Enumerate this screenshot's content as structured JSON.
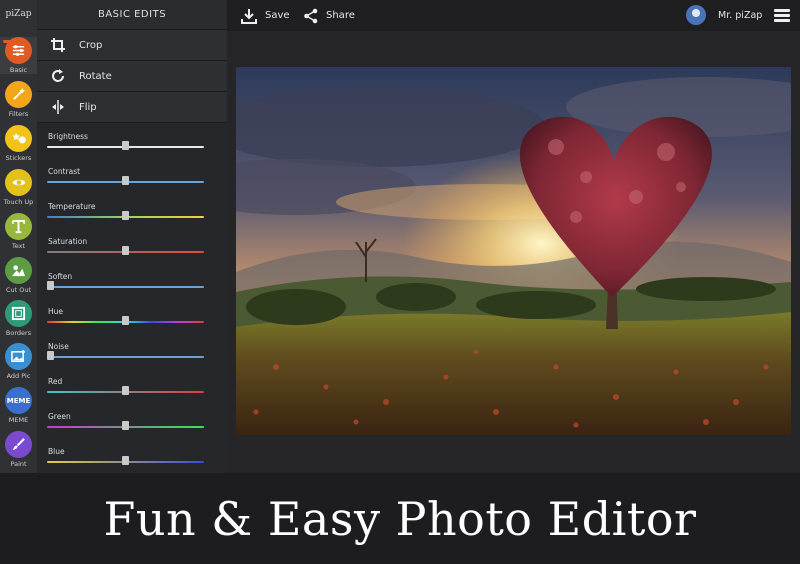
{
  "app": {
    "logo": "piZap"
  },
  "tools": [
    {
      "label": "Basic",
      "icon": "sliders-icon",
      "color": "#e05a24",
      "active": true
    },
    {
      "label": "Filters",
      "icon": "magic-wand-icon",
      "color": "#f2a71b"
    },
    {
      "label": "Stickers",
      "icon": "stickers-icon",
      "color": "#f2c318"
    },
    {
      "label": "Touch Up",
      "icon": "eye-icon",
      "color": "#e2c21a"
    },
    {
      "label": "Text",
      "icon": "text-t-icon",
      "color": "#97b83a"
    },
    {
      "label": "Cut Out",
      "icon": "cutout-icon",
      "color": "#5e9c44"
    },
    {
      "label": "Borders",
      "icon": "border-frame-icon",
      "color": "#2f9a7a"
    },
    {
      "label": "Add Pic",
      "icon": "add-picture-icon",
      "color": "#3a8fd0"
    },
    {
      "label": "MEME",
      "icon": "meme-icon",
      "color": "#3a6fcf",
      "badge": "MEME"
    },
    {
      "label": "Paint",
      "icon": "paint-brush-icon",
      "color": "#7b4bcf"
    }
  ],
  "panel": {
    "title": "BASIC EDITS",
    "actions": [
      {
        "label": "Crop",
        "icon": "crop-icon"
      },
      {
        "label": "Rotate",
        "icon": "rotate-icon"
      },
      {
        "label": "Flip",
        "icon": "flip-icon"
      }
    ],
    "sliders": [
      {
        "label": "Brightness",
        "value": 0.5,
        "track": "#e8e8e8"
      },
      {
        "label": "Contrast",
        "value": 0.5,
        "track": "#6aa3d6"
      },
      {
        "label": "Temperature",
        "value": 0.5,
        "track": "linear-gradient(90deg,#3d7fd4,#9bd45a,#f0d23a)"
      },
      {
        "label": "Saturation",
        "value": 0.5,
        "track": "linear-gradient(90deg,#7d7d7d,#e24b3b)"
      },
      {
        "label": "Soften",
        "value": 0.0,
        "track": "#6aa3d6"
      },
      {
        "label": "Hue",
        "value": 0.5,
        "track": "linear-gradient(90deg,#e23b3b,#e2d13b,#3be25a,#3bd6e2,#3b4be2,#c63be2,#e23b3b)"
      },
      {
        "label": "Noise",
        "value": 0.0,
        "track": "#6aa3d6"
      },
      {
        "label": "Red",
        "value": 0.5,
        "track": "linear-gradient(90deg,#3bc6c6,#e23b3b)"
      },
      {
        "label": "Green",
        "value": 0.5,
        "track": "linear-gradient(90deg,#c63bc6,#3be25a)"
      },
      {
        "label": "Blue",
        "value": 0.5,
        "track": "linear-gradient(90deg,#e2d13b,#3b4be2)"
      }
    ]
  },
  "topbar": {
    "save_label": "Save",
    "share_label": "Share",
    "user_name": "Mr. piZap"
  },
  "caption": "Fun & Easy Photo Editor"
}
